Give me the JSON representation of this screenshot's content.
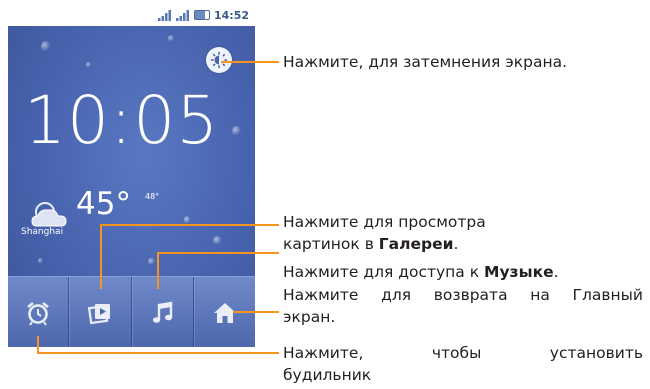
{
  "status_bar": {
    "time": "14:52"
  },
  "widget": {
    "clock": "10:05",
    "temperature": "45°",
    "temperature_small": "48°",
    "city": "Shanghai"
  },
  "dock": {
    "items": [
      "alarm-clock-icon",
      "gallery-icon",
      "music-icon",
      "home-icon"
    ]
  },
  "callouts": {
    "dim_screen": "Нажмите, для затемнения экрана.",
    "gallery_line1": "Нажмите для просмотра",
    "gallery_line2_prefix": "картинок в ",
    "gallery_line2_bold": "Галереи",
    "gallery_line2_suffix": ".",
    "music_prefix": "Нажмите для доступа к ",
    "music_bold": "Музыке",
    "music_suffix": ".",
    "home_line1": "Нажмите для возврата на Главный",
    "home_line2": "экран.",
    "alarm_line1": "Нажмите, чтобы установить",
    "alarm_line2": "будильник"
  },
  "colors": {
    "callout_line": "#f7941d",
    "screen_blue": "#4863ae"
  }
}
